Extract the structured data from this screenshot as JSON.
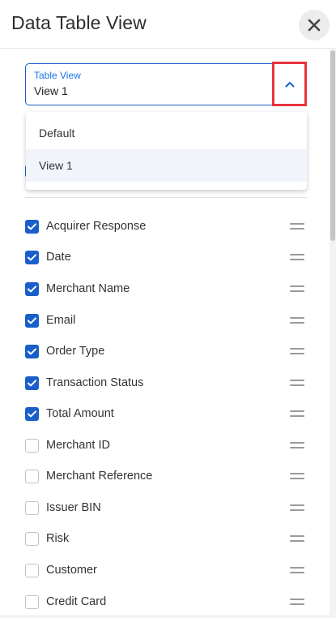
{
  "header": {
    "title": "Data Table View"
  },
  "table_view_select": {
    "label": "Table View",
    "value": "View 1",
    "options": [
      {
        "label": "Default",
        "selected": false
      },
      {
        "label": "View 1",
        "selected": true
      }
    ]
  },
  "columns": [
    {
      "label": "Acquirer Response",
      "checked": true
    },
    {
      "label": "Date",
      "checked": true
    },
    {
      "label": "Merchant Name",
      "checked": true
    },
    {
      "label": "Email",
      "checked": true
    },
    {
      "label": "Order Type",
      "checked": true
    },
    {
      "label": "Transaction Status",
      "checked": true
    },
    {
      "label": "Total Amount",
      "checked": true
    },
    {
      "label": "Merchant ID",
      "checked": false
    },
    {
      "label": "Merchant Reference",
      "checked": false
    },
    {
      "label": "Issuer BIN",
      "checked": false
    },
    {
      "label": "Risk",
      "checked": false
    },
    {
      "label": "Customer",
      "checked": false
    },
    {
      "label": "Credit Card",
      "checked": false
    }
  ],
  "icons": {
    "close": "close-icon",
    "chevron": "chevron-up-icon",
    "checkbox_checked": "checkmark-icon",
    "drag_handle": "drag-handle-icon"
  },
  "colors": {
    "accent": "#1a5fc9",
    "highlight_border": "#e8343f",
    "selected_option_bg": "#f1f4fb"
  }
}
